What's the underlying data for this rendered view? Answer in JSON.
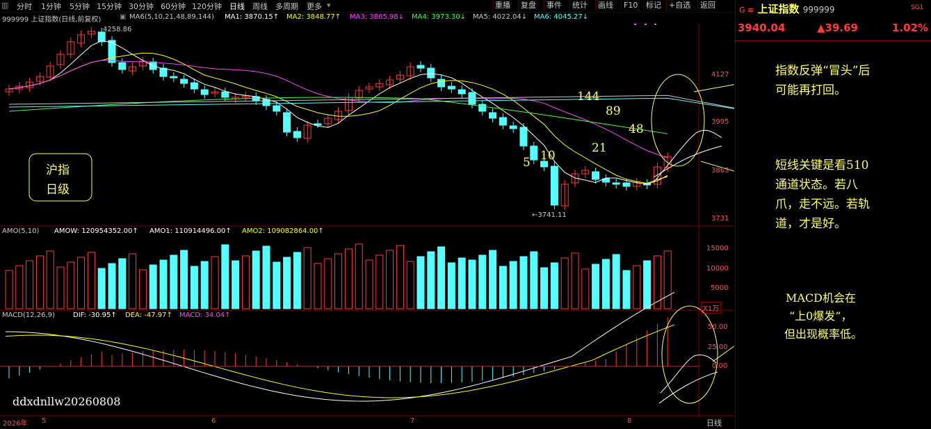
{
  "toolbar": {
    "items": [
      "分时",
      "1分钟",
      "5分钟",
      "15分钟",
      "30分钟",
      "60分钟",
      "120分钟",
      "日线",
      "周线",
      "多周期",
      "更多"
    ],
    "right_items": [
      "重播",
      "复盘",
      "事件",
      "统计",
      "画线",
      "F10",
      "标记",
      "+自选",
      "返回"
    ]
  },
  "indicator_bar": {
    "symbol": "999999 上证指数(日线,前复权)",
    "ma_label": "MA6(5,10,21,48,89,144)",
    "ma1": "MA1: 3870.15↑",
    "ma2": "MA2: 3848.77↑",
    "ma3": "MA3: 3865.98↓",
    "ma4": "MA4: 3973.30↓",
    "ma5": "MA5: 4022.04↓",
    "ma6": "MA6: 4045.27↓"
  },
  "amo_bar": {
    "label": "AMO(5,10)",
    "amow": "AMOW: 120954352.00↑",
    "amo1": "AMO1: 110914496.00↑",
    "amo2": "AMO2: 109082864.00↑"
  },
  "macd_bar": {
    "label": "MACD(12,26,9)",
    "dif": "DIF: -30.95↑",
    "dea": "DEA: -47.97↑",
    "macd": "MACD: 34.04↑"
  },
  "price_axis": [
    "4127",
    "3995",
    "3863",
    "3731"
  ],
  "vol_axis": [
    "15000",
    "10000",
    "5000"
  ],
  "vol_unit": "X1万",
  "macd_axis": [
    "50.00",
    "25.00",
    "0.00"
  ],
  "dates": [
    "2026年",
    "5",
    "6",
    "7",
    "8"
  ],
  "period_label": "日线",
  "annotations": {
    "high": "4258.86",
    "low": "←3741.11",
    "ma_numbers": [
      "5",
      "10",
      "21",
      "48",
      "89",
      "144"
    ],
    "box_label_line1": "沪指",
    "box_label_line2": "日级",
    "watermark": "ddxdnllw20260808"
  },
  "notes": {
    "note1_line1": "指数反弹“冒头”后",
    "note1_line2": "可能再打回。",
    "note2_line1": "短线关键是看510",
    "note2_line2": "通道状态。若八",
    "note2_line3": "爪，走不远。若轨",
    "note2_line4": "道，才是好。",
    "note3_line1": "MACD机会在",
    "note3_line2": "“上0爆发”，",
    "note3_line3": "但出现概率低。"
  },
  "quote": {
    "prefix": "G ≡",
    "name": "上证指数",
    "code": "999999",
    "tag": "SG1",
    "price": "3940.04",
    "change": "▲39.69",
    "pct": "1.02%"
  },
  "colors": {
    "up": "#ff3b3b",
    "down": "#54ffff",
    "note": "#ffff66"
  }
}
